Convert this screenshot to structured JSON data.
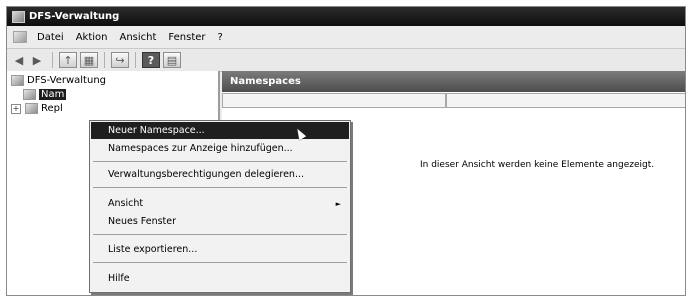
{
  "window": {
    "title": "DFS-Verwaltung"
  },
  "menubar": {
    "items": [
      "Datei",
      "Aktion",
      "Ansicht",
      "Fenster",
      "?"
    ]
  },
  "toolbar": {
    "buttons": [
      "back-icon",
      "forward-icon",
      "up-icon",
      "show-hide-tree-icon",
      "export-icon",
      "help-icon",
      "properties-icon"
    ],
    "help_glyph": "?"
  },
  "tree": {
    "root": {
      "label": "DFS-Verwaltung"
    },
    "items": [
      {
        "label": "Namespaces",
        "visible_label": "Nam",
        "selected": true
      },
      {
        "label": "Replikation",
        "visible_label": "Repl",
        "expander": "+"
      }
    ]
  },
  "content": {
    "header": "Namespaces",
    "empty_message": "In dieser Ansicht werden keine Elemente angezeigt."
  },
  "context_menu": {
    "items": [
      {
        "label": "Neuer Namespace...",
        "highlighted": true
      },
      {
        "label": "Namespaces zur Anzeige hinzufügen..."
      },
      {
        "separator": true
      },
      {
        "label": "Verwaltungsberechtigungen delegieren..."
      },
      {
        "separator": true
      },
      {
        "label": "Ansicht",
        "submenu": true,
        "arrow": "►"
      },
      {
        "label": "Neues Fenster"
      },
      {
        "separator": true
      },
      {
        "label": "Liste exportieren..."
      },
      {
        "separator": true
      },
      {
        "label": "Hilfe"
      }
    ]
  },
  "colors": {
    "titlebar": "#0e0e0e",
    "highlight": "#1f1f1f",
    "menu_bg": "#f2f2f2"
  }
}
